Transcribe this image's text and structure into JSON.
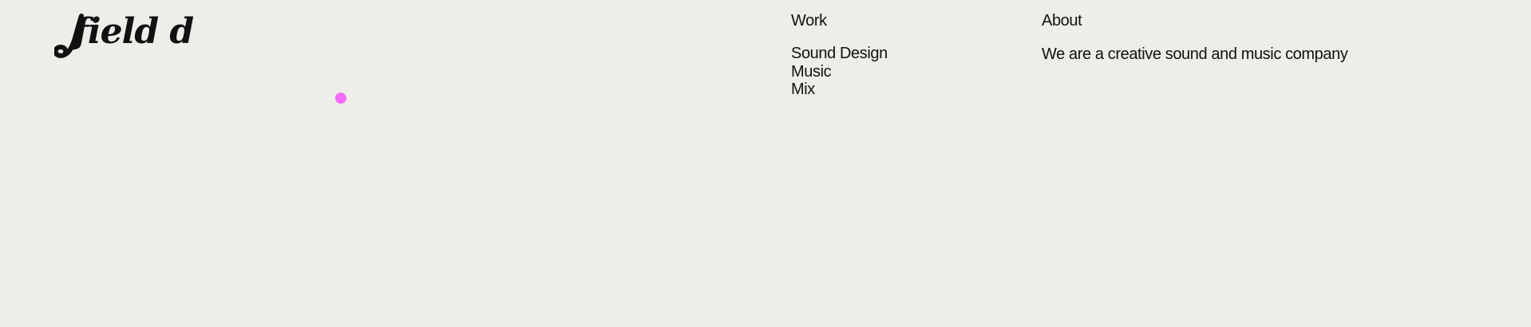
{
  "brand": {
    "logo_text": "field day",
    "logo_color": "#111111"
  },
  "cursor": {
    "color": "#f56ef9"
  },
  "nav": {
    "work": {
      "heading": "Work",
      "items": [
        {
          "label": "Sound Design"
        },
        {
          "label": "Music"
        },
        {
          "label": "Mix"
        }
      ]
    },
    "about": {
      "heading": "About",
      "description": "We are a creative sound and music company"
    }
  },
  "theme": {
    "background": "#efede9",
    "text": "#111111"
  }
}
